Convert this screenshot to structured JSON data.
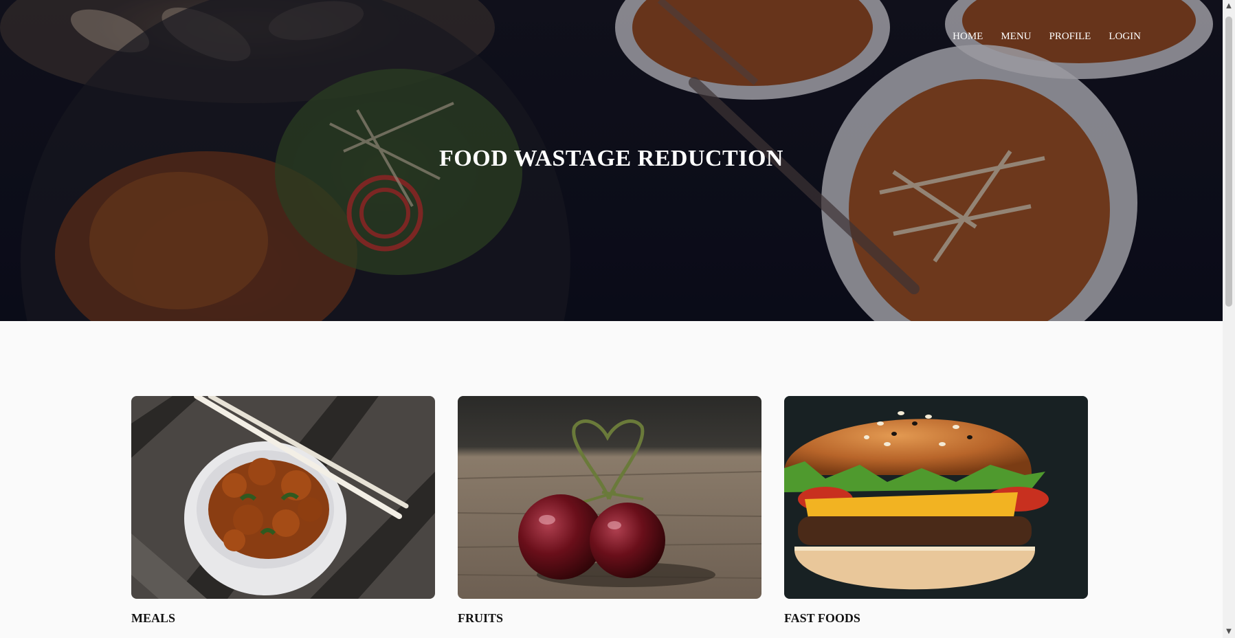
{
  "header": {
    "title": "FOOD WASTAGE REDUCTION",
    "nav": [
      "HOME",
      "MENU",
      "PROFILE",
      "LOGIN"
    ]
  },
  "categories": [
    {
      "label": "MEALS",
      "image": "bowl-of-glazed-meat-with-chopsticks"
    },
    {
      "label": "FRUITS",
      "image": "heart-shaped-cherries-on-wood"
    },
    {
      "label": "FAST FOODS",
      "image": "cheeseburger"
    }
  ],
  "colors": {
    "page_bg": "#fafafa",
    "hero_bg": "#0c0e18",
    "title": "#ffffff",
    "label": "#111111"
  },
  "scrollbar": {
    "up_icon": "▲",
    "down_icon": "▼"
  }
}
